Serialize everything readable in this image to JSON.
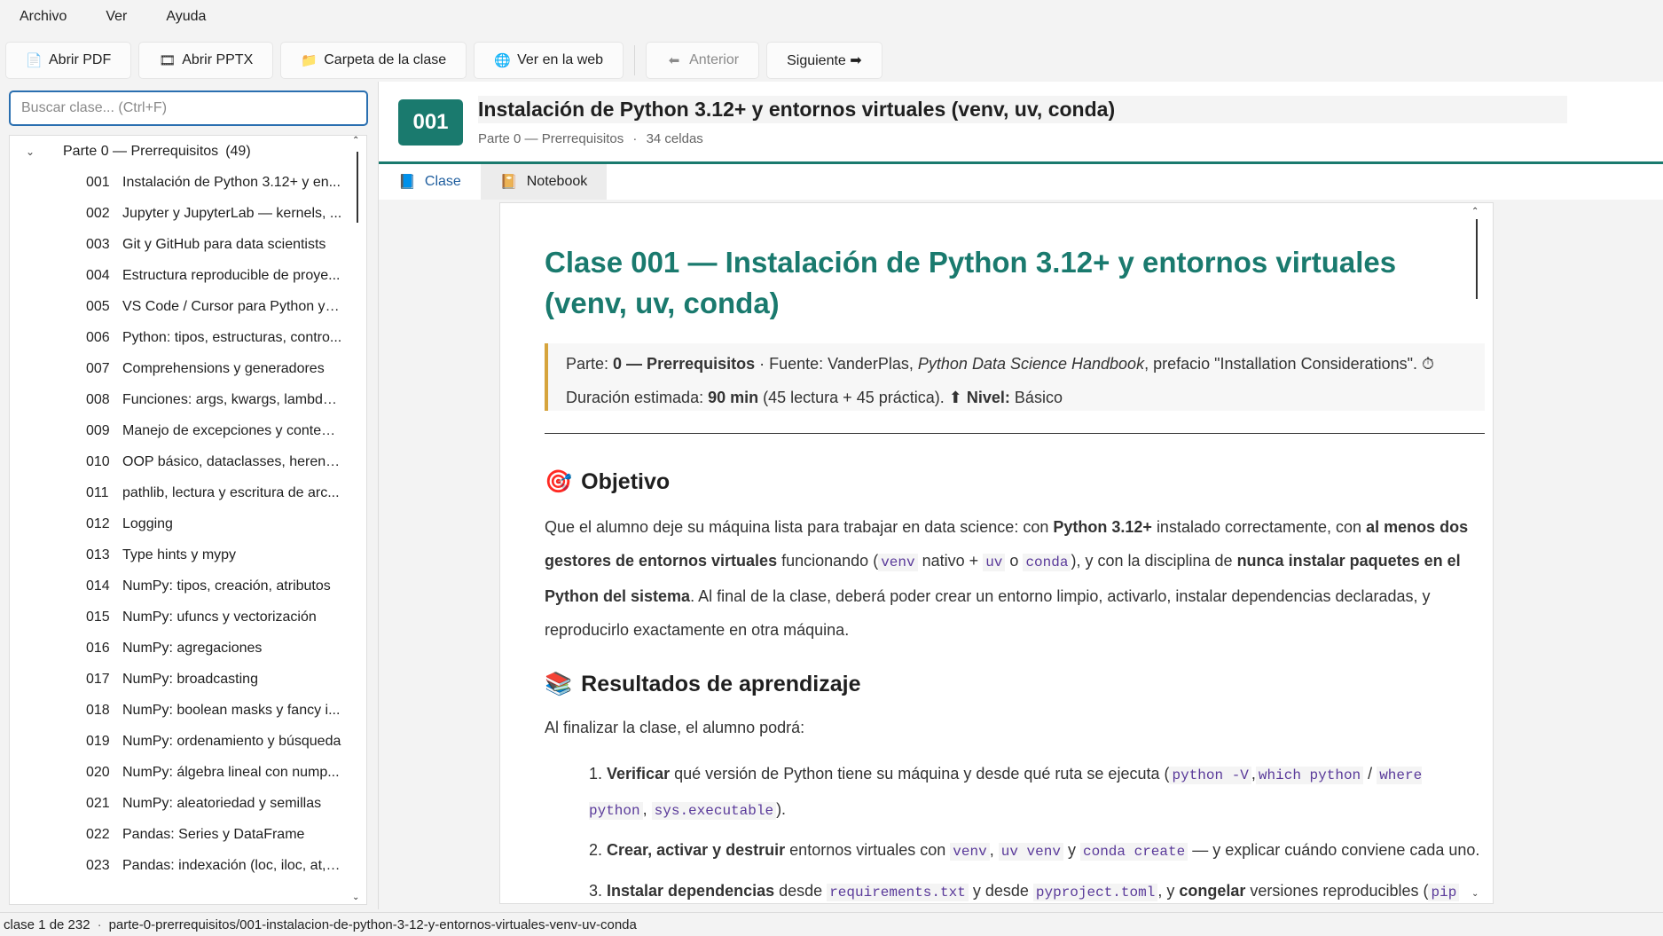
{
  "menu": [
    "Archivo",
    "Ver",
    "Ayuda"
  ],
  "toolbar": {
    "open_pdf": "Abrir PDF",
    "open_pptx": "Abrir PPTX",
    "class_folder": "Carpeta de la clase",
    "view_web": "Ver en la web",
    "previous": "Anterior",
    "next": "Siguiente ➡"
  },
  "sidebar": {
    "search_placeholder": "Buscar clase... (Ctrl+F)",
    "group": {
      "title": "Parte 0 — Prerrequisitos",
      "count": "(49)"
    },
    "items": [
      {
        "num": "001",
        "title": "Instalación de Python 3.12+ y en..."
      },
      {
        "num": "002",
        "title": "Jupyter y JupyterLab — kernels, ..."
      },
      {
        "num": "003",
        "title": "Git y GitHub para data scientists"
      },
      {
        "num": "004",
        "title": "Estructura reproducible de proye..."
      },
      {
        "num": "005",
        "title": "VS Code / Cursor para Python y J..."
      },
      {
        "num": "006",
        "title": "Python: tipos, estructuras, contro..."
      },
      {
        "num": "007",
        "title": "Comprehensions y generadores"
      },
      {
        "num": "008",
        "title": "Funciones: args, kwargs, lambdas..."
      },
      {
        "num": "009",
        "title": "Manejo de excepciones y context..."
      },
      {
        "num": "010",
        "title": "OOP básico, dataclasses, herencia"
      },
      {
        "num": "011",
        "title": "pathlib, lectura y escritura de arc..."
      },
      {
        "num": "012",
        "title": "Logging"
      },
      {
        "num": "013",
        "title": "Type hints y mypy"
      },
      {
        "num": "014",
        "title": "NumPy: tipos, creación, atributos"
      },
      {
        "num": "015",
        "title": "NumPy: ufuncs y vectorización"
      },
      {
        "num": "016",
        "title": "NumPy: agregaciones"
      },
      {
        "num": "017",
        "title": "NumPy: broadcasting"
      },
      {
        "num": "018",
        "title": "NumPy: boolean masks y fancy i..."
      },
      {
        "num": "019",
        "title": "NumPy: ordenamiento y búsqueda"
      },
      {
        "num": "020",
        "title": "NumPy: álgebra lineal con nump..."
      },
      {
        "num": "021",
        "title": "NumPy: aleatoriedad y semillas"
      },
      {
        "num": "022",
        "title": "Pandas: Series y DataFrame"
      },
      {
        "num": "023",
        "title": "Pandas: indexación (loc, iloc, at, i..."
      }
    ]
  },
  "header": {
    "badge": "001",
    "title": "Instalación de Python 3.12+ y entornos virtuales (venv, uv, conda)",
    "part": "Parte 0 — Prerrequisitos",
    "dot": "·",
    "cells": "34 celdas"
  },
  "tabs": [
    {
      "label": "Clase",
      "icon": "book-icon",
      "active": true
    },
    {
      "label": "Notebook",
      "icon": "notebook-icon",
      "active": false
    }
  ],
  "doc": {
    "title": "Clase 001 — Instalación de Python 3.12+ y entornos virtuales (venv, uv, conda)",
    "meta": {
      "part_label": "Parte:",
      "part_value": "0 — Prerrequisitos",
      "source_label": "· Fuente: VanderPlas,",
      "source_book": "Python Data Science Handbook",
      "source_rest": ", prefacio \"Installation Considerations\".",
      "timer_icon": "⏱",
      "duration_label": "Duración estimada:",
      "duration_value": "90 min",
      "duration_rest": "(45 lectura + 45 práctica).",
      "level_icon": "⬆",
      "level_label": "Nivel:",
      "level_value": "Básico"
    },
    "objective": {
      "icon": "🎯",
      "heading": "Objetivo",
      "t1": "Que el alumno deje su máquina lista para trabajar en data science: con",
      "b1": "Python 3.12+",
      "t2": "instalado correctamente, con",
      "b2": "al menos dos gestores de entornos virtuales",
      "t3": "funcionando (",
      "c1": "venv",
      "t4": "nativo +",
      "c2": "uv",
      "t5": "o",
      "c3": "conda",
      "t6": "), y con la disciplina de",
      "b3": "nunca instalar paquetes en el Python del sistema",
      "t7": ". Al final de la clase, deberá poder crear un entorno limpio, activarlo, instalar dependencias declaradas, y reproducirlo exactamente en otra máquina."
    },
    "outcomes": {
      "icon": "📚",
      "heading": "Resultados de aprendizaje",
      "intro": "Al finalizar la clase, el alumno podrá:",
      "item1": {
        "num": "1.",
        "b": "Verificar",
        "t1": "qué versión de Python tiene su máquina y desde qué ruta se ejecuta (",
        "c1": "python -V",
        "t2": ",",
        "c2": "which python",
        "t3": "/",
        "c3": "where python",
        "t4": ",",
        "c4": "sys.executable",
        "t5": ")."
      },
      "item2": {
        "num": "2.",
        "b": "Crear, activar y destruir",
        "t1": "entornos virtuales con",
        "c1": "venv",
        "t2": ",",
        "c2": "uv venv",
        "t3": "y",
        "c3": "conda create",
        "t4": "— y explicar cuándo conviene cada uno."
      },
      "item3": {
        "num": "3.",
        "b": "Instalar dependencias",
        "t1": "desde",
        "c1": "requirements.txt",
        "t2": "y desde",
        "c2": "pyproject.toml",
        "t3": ", y",
        "b2": "congelar",
        "t4": "versiones reproducibles (",
        "c3": "pip"
      }
    }
  },
  "status": {
    "position": "clase 1 de 232",
    "sep": "·",
    "path": "parte-0-prerrequisitos/001-instalacion-de-python-3-12-y-entornos-virtuales-venv-uv-conda"
  },
  "colors": {
    "accent": "#1a7a6e",
    "tab_active": "#1f5e9e",
    "meta_border": "#d6a43c",
    "code": "#5a3a9a"
  }
}
